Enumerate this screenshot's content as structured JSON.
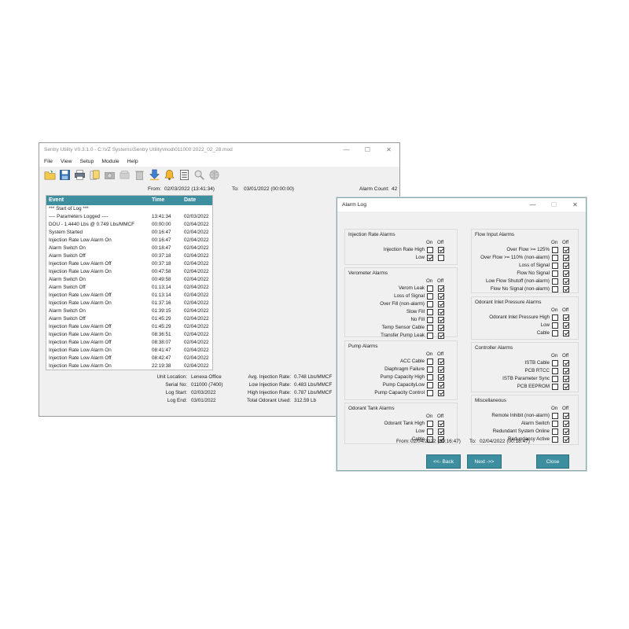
{
  "main": {
    "title": "Sentry Utility V0.3.1.0 - C:\\VZ Systems\\Sentry Utility\\mod\\011000 2022_02_28.mod",
    "menu": [
      "File",
      "View",
      "Setup",
      "Module",
      "Help"
    ],
    "toolbar_icons": [
      "open-folder-icon",
      "save-icon",
      "print-icon",
      "cards-icon",
      "camera-icon",
      "disabled-tool-icon",
      "trash-icon",
      "download-icon",
      "bell-icon",
      "checklist-icon",
      "magnifier-icon",
      "globe-icon"
    ],
    "from_label": "From:",
    "from_value": "02/03/2022 (13:41:34)",
    "to_label": "To:",
    "to_value": "03/01/2022 (00:00:00)",
    "alarm_count_label": "Alarm Count:",
    "alarm_count": "42",
    "columns": [
      "Event",
      "Time",
      "Date"
    ],
    "events": [
      [
        "*** Start of Log ***",
        "",
        ""
      ],
      [
        "---- Parameters Logged ----",
        "13:41:34",
        "02/03/2022"
      ],
      [
        "DOU - 1.4440 Lbs @ 0.749 Lbs/MMCF",
        "00:00:00",
        "02/04/2022"
      ],
      [
        "System Started",
        "00:16:47",
        "02/04/2022"
      ],
      [
        "Injection Rate Low Alarm On",
        "00:16:47",
        "02/04/2022"
      ],
      [
        "Alarm Switch On",
        "00:18:47",
        "02/04/2022"
      ],
      [
        "Alarm Switch Off",
        "00:37:18",
        "02/04/2022"
      ],
      [
        "Injection Rate Low Alarm Off",
        "00:37:18",
        "02/04/2022"
      ],
      [
        "Injection Rate Low Alarm On",
        "00:47:58",
        "02/04/2022"
      ],
      [
        "Alarm Switch On",
        "00:49:58",
        "02/04/2022"
      ],
      [
        "Alarm Switch Off",
        "01:13:14",
        "02/04/2022"
      ],
      [
        "Injection Rate Low Alarm Off",
        "01:13:14",
        "02/04/2022"
      ],
      [
        "Injection Rate Low Alarm On",
        "01:37:16",
        "02/04/2022"
      ],
      [
        "Alarm Switch On",
        "01:39:15",
        "02/04/2022"
      ],
      [
        "Alarm Switch Off",
        "01:45:29",
        "02/04/2022"
      ],
      [
        "Injection Rate Low Alarm Off",
        "01:45:29",
        "02/04/2022"
      ],
      [
        "Injection Rate Low Alarm On",
        "08:36:51",
        "02/04/2022"
      ],
      [
        "Injection Rate Low Alarm Off",
        "08:38:07",
        "02/04/2022"
      ],
      [
        "Injection Rate Low Alarm On",
        "08:41:47",
        "02/04/2022"
      ],
      [
        "Injection Rate Low Alarm Off",
        "08:42:47",
        "02/04/2022"
      ],
      [
        "Injection Rate Low Alarm On",
        "22:19:38",
        "02/04/2022"
      ]
    ],
    "summary_left": [
      [
        "Unit Location:",
        "Lenexa Office"
      ],
      [
        "Serial No:",
        "011000 (7400)"
      ],
      [
        "Log Start:",
        "02/03/2022"
      ],
      [
        "Log End:",
        "03/01/2022"
      ]
    ],
    "summary_right": [
      [
        "Avg. Injection Rate:",
        "0.748 Lbs/MMCF"
      ],
      [
        "Low Injection Rate:",
        "0.483 Lbs/MMCF"
      ],
      [
        "High Injection Rate:",
        "0.787 Lbs/MMCF"
      ],
      [
        "Total Odorant Used:",
        "312.59 Lb"
      ]
    ]
  },
  "alarm": {
    "title": "Alarm Log",
    "on_label": "On",
    "off_label": "Off",
    "groups": [
      {
        "title": "Injection Rate Alarms",
        "rows": [
          [
            "Injection Rate High",
            false,
            true
          ],
          [
            "Low",
            true,
            false
          ]
        ]
      },
      {
        "title": "Verometer Alarms",
        "rows": [
          [
            "Verom Leak",
            false,
            true
          ],
          [
            "Loss of Signal",
            false,
            true
          ],
          [
            "Over Fill (non-alarm)",
            false,
            true
          ],
          [
            "Slow Fill",
            false,
            true
          ],
          [
            "No Fill",
            false,
            true
          ],
          [
            "Temp Sensor Cable",
            false,
            true
          ],
          [
            "Transfer Pump Leak",
            false,
            true
          ]
        ]
      },
      {
        "title": "Pump Alarms",
        "rows": [
          [
            "ACC Cable",
            false,
            true
          ],
          [
            "Diaphragm Failure",
            false,
            true
          ],
          [
            "Pump Capacity High",
            false,
            true
          ],
          [
            "Pump CapacityLow",
            false,
            true
          ],
          [
            "Pump Capacity Control",
            false,
            true
          ]
        ]
      },
      {
        "title": "Odorant Tank Alarms",
        "rows": [
          [
            "Odorant Tank High",
            false,
            true
          ],
          [
            "Low",
            false,
            true
          ],
          [
            "Cable",
            false,
            true
          ]
        ]
      },
      {
        "title": "Flow Input Alarms",
        "rows": [
          [
            "Over Flow >= 125%",
            false,
            true
          ],
          [
            "Over Flow >= 110% (non-alarm)",
            false,
            true
          ],
          [
            "Loss of Signal",
            false,
            true
          ],
          [
            "Flow No Signal",
            false,
            true
          ],
          [
            "Low Flow Shutoff (non-alarm)",
            false,
            true
          ],
          [
            "Flow No Signal (non-alarm)",
            false,
            true
          ]
        ]
      },
      {
        "title": "Odorant Inlet Pressure Alarms",
        "rows": [
          [
            "Odorant Inlet Pressure High",
            false,
            true
          ],
          [
            "Low",
            false,
            true
          ],
          [
            "Cable",
            false,
            true
          ]
        ]
      },
      {
        "title": "Controller Alarms",
        "rows": [
          [
            "ISTB Cable",
            false,
            true
          ],
          [
            "PCB RTCC",
            false,
            true
          ],
          [
            "ISTB Parameter Sync",
            false,
            true
          ],
          [
            "PCB EEPROM",
            false,
            true
          ]
        ]
      },
      {
        "title": "Miscellaneous",
        "rows": [
          [
            "Remote Inhibit (non-alarm)",
            false,
            true
          ],
          [
            "Alarm Switch",
            false,
            true
          ],
          [
            "Redundant System Online",
            false,
            true
          ],
          [
            "Redundancy Active",
            false,
            true
          ]
        ]
      }
    ],
    "from_label": "From:",
    "from_value": "02/04/2022 (00:16:47)",
    "to_label": "To:",
    "to_value": "02/04/2022 (00:18:47)",
    "back_label": "<<- Back",
    "next_label": "Next ->>",
    "close_label": "Close"
  }
}
